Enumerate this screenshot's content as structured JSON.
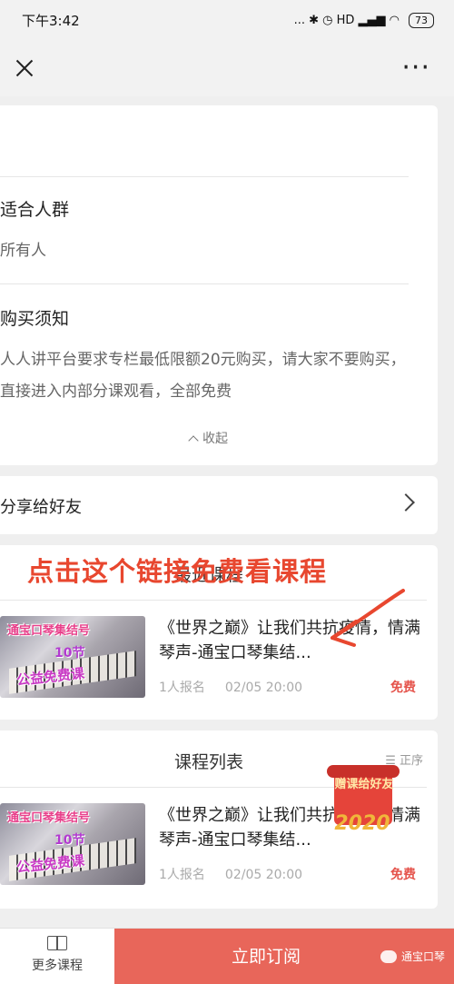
{
  "status_bar": {
    "time": "下午3:42",
    "network_icons": "... ✱ ◷ HD ▂▄▆ ◠",
    "battery": "73"
  },
  "sections": [
    {
      "title": "适合人群",
      "text": "所有人"
    },
    {
      "title": "购买须知",
      "text": "人人讲平台要求专栏最低限额20元购买，请大家不要购买，直接进入内部分课观看，全部免费"
    }
  ],
  "collapse_label": "收起",
  "share_label": "分享给好友",
  "annotation": "点击这个链接免费看课程",
  "recent": {
    "header": "最近课程",
    "course": {
      "thumb_line1": "通宝口琴集结号",
      "thumb_line2": "10节",
      "thumb_line3": "公益免费课",
      "title": "《世界之巅》让我们共抗疫情，情满琴声-通宝口琴集结...",
      "enrolled": "1人报名",
      "datetime": "02/05 20:00",
      "price": "免费"
    }
  },
  "course_list": {
    "header": "课程列表",
    "sort_label": "正序",
    "course": {
      "thumb_line1": "通宝口琴集结号",
      "thumb_line2": "10节",
      "thumb_line3": "公益免费课",
      "title": "《世界之巅》让我们共抗疫情，情满琴声-通宝口琴集结...",
      "enrolled": "1人报名",
      "datetime": "02/05 20:00",
      "price": "免费"
    }
  },
  "gift_badge": {
    "label": "赠课给好友",
    "year": "2020"
  },
  "bottom": {
    "more_label": "更多课程",
    "subscribe_label": "立即订阅",
    "watermark": "通宝口琴"
  },
  "colors": {
    "accent": "#e8665a",
    "price": "#e5534b",
    "annotation": "#e8472f"
  }
}
